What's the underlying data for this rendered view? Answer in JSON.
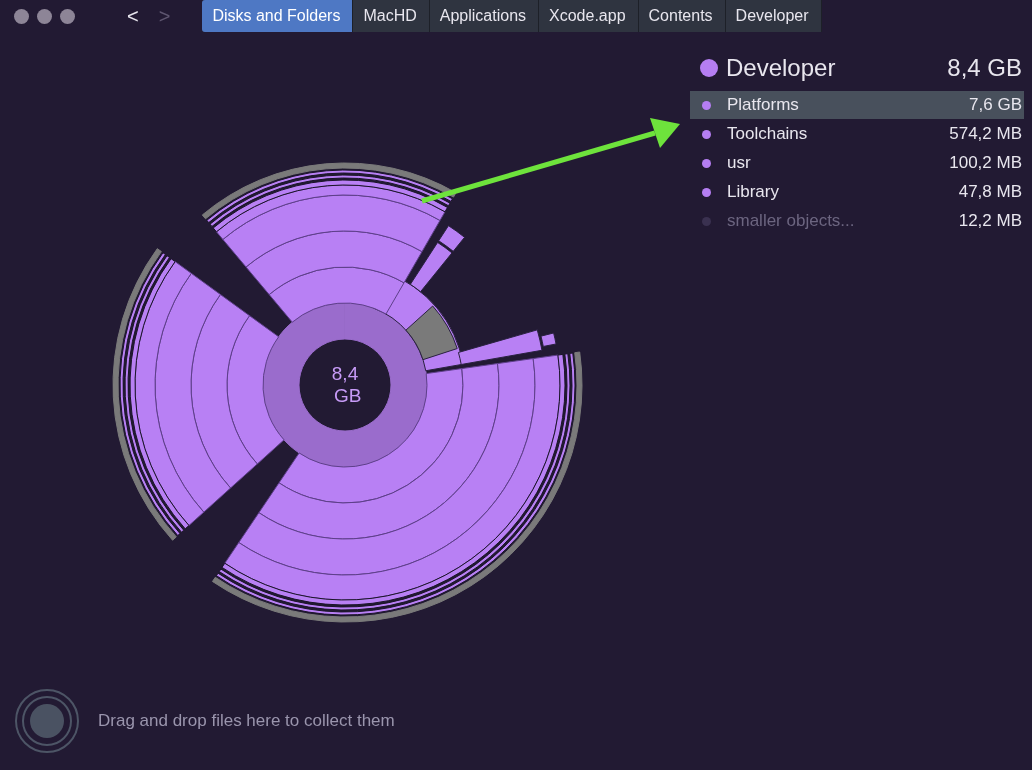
{
  "navigation": [
    {
      "glyph": "<",
      "disabled": false
    },
    {
      "glyph": ">",
      "disabled": true
    }
  ],
  "breadcrumbs": [
    {
      "label": "Disks and Folders",
      "selected": true
    },
    {
      "label": "MacHD",
      "selected": false
    },
    {
      "label": "Applications",
      "selected": false
    },
    {
      "label": "Xcode.app",
      "selected": false
    },
    {
      "label": "Contents",
      "selected": false
    },
    {
      "label": "Developer",
      "selected": false
    }
  ],
  "chart": {
    "center_label": "8,4 GB"
  },
  "details": {
    "title": "Developer",
    "size": "8,4 GB",
    "color": "#b57ef2",
    "items": [
      {
        "name": "Platforms",
        "size": "7,6 GB",
        "color": "#b57ef2",
        "selected": true,
        "dimmed": false
      },
      {
        "name": "Toolchains",
        "size": "574,2 MB",
        "color": "#b57ef2",
        "selected": false,
        "dimmed": false
      },
      {
        "name": "usr",
        "size": "100,2 MB",
        "color": "#b57ef2",
        "selected": false,
        "dimmed": false
      },
      {
        "name": "Library",
        "size": "47,8 MB",
        "color": "#b57ef2",
        "selected": false,
        "dimmed": false
      },
      {
        "name": "smaller objects...",
        "size": "12,2 MB",
        "color": "#3a3150",
        "selected": false,
        "dimmed": true
      }
    ]
  },
  "footer": {
    "hint": "Drag and drop files here to collect them"
  }
}
